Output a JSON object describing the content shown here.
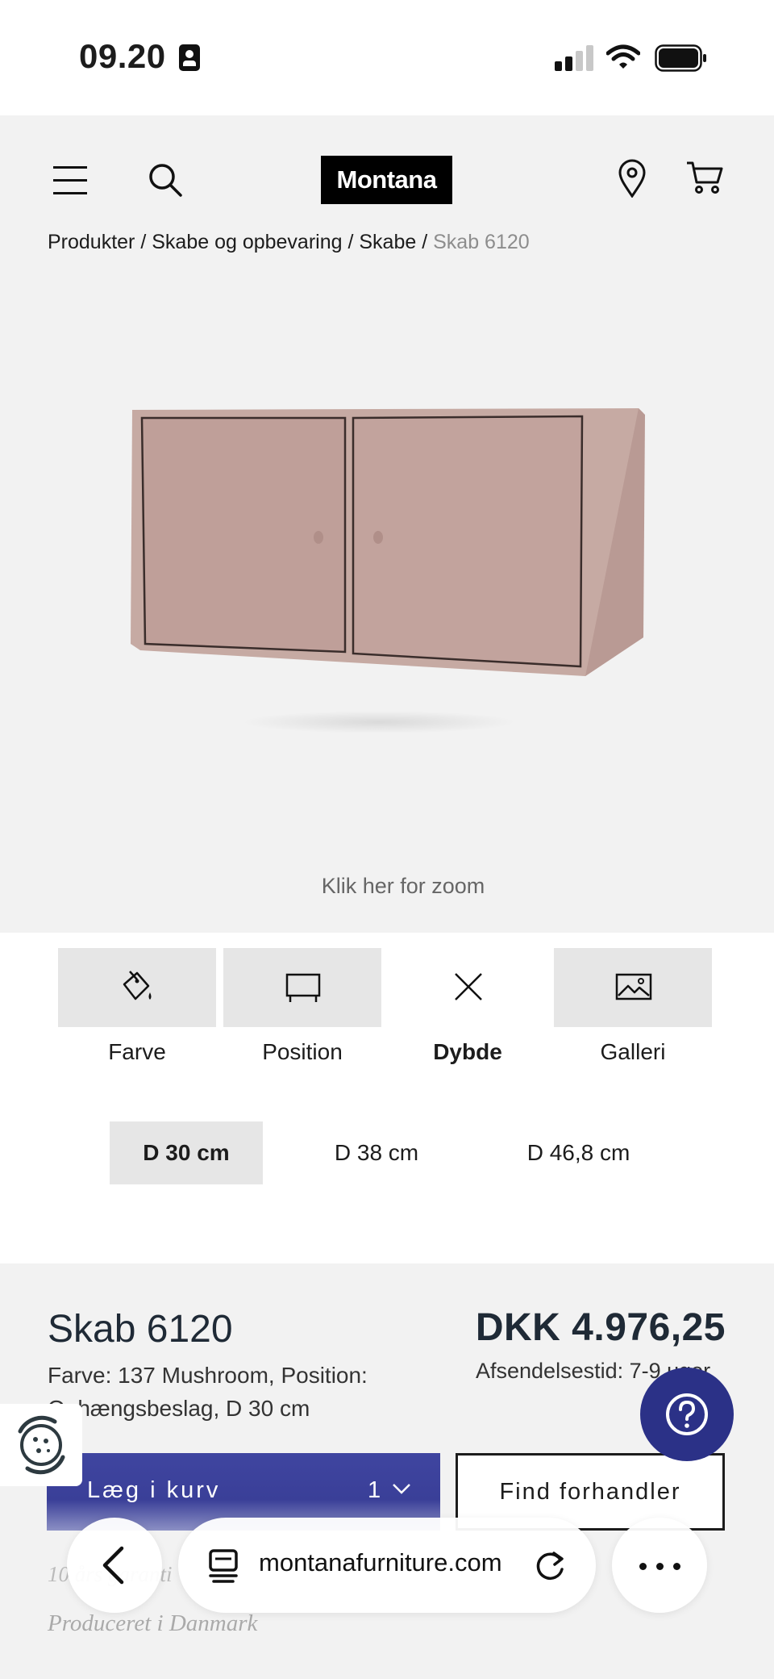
{
  "status_bar": {
    "time": "09.20"
  },
  "header": {
    "logo_text": "Montana",
    "icons": [
      "menu-icon",
      "search-icon",
      "location-pin-icon",
      "cart-icon"
    ]
  },
  "breadcrumb": {
    "items": [
      "Produkter",
      "Skabe og opbevaring",
      "Skabe"
    ],
    "separator": " / ",
    "current": "Skab 6120"
  },
  "image": {
    "zoom_hint": "Klik her for zoom",
    "cabinet_color": "#c3a6a0"
  },
  "tabs": [
    {
      "label": "Farve",
      "icon": "paint-bucket-icon",
      "active": false
    },
    {
      "label": "Position",
      "icon": "wall-position-icon",
      "active": false
    },
    {
      "label": "Dybde",
      "icon": "close-icon",
      "active": true
    },
    {
      "label": "Galleri",
      "icon": "gallery-image-icon",
      "active": false
    }
  ],
  "depth_options": [
    {
      "label": "D 30 cm",
      "selected": true
    },
    {
      "label": "D 38 cm",
      "selected": false
    },
    {
      "label": "D 46,8 cm",
      "selected": false
    }
  ],
  "summary": {
    "product_name": "Skab 6120",
    "description": "Farve: 137 Mushroom, Position: Ophængsbeslag, D 30 cm",
    "price": "DKK 4.976,25",
    "shipping": "Afsendelsestid: 7-9 uger"
  },
  "actions": {
    "add_to_cart": "Læg i kurv",
    "quantity": "1",
    "find_dealer": "Find forhandler"
  },
  "footer": {
    "line1": "10 års garanti",
    "line2": "Produceret i Danmark"
  },
  "browser": {
    "url": "montanafurniture.com"
  },
  "colors": {
    "accent": "#3a3f98",
    "help": "#2b3187",
    "panel": "#f2f2f2"
  }
}
